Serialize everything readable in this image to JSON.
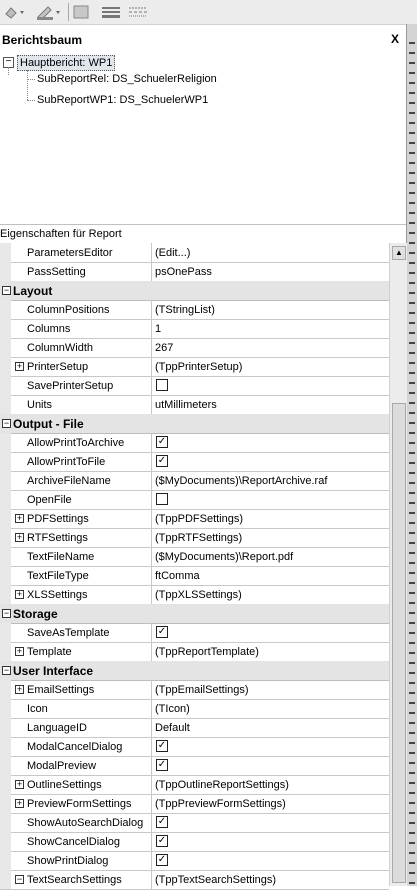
{
  "toolbar": {
    "icons": [
      "fill-color-icon",
      "pen-color-icon",
      "line-style-icon",
      "line-width-icon",
      "line-dash-icon"
    ]
  },
  "tree": {
    "title": "Berichtsbaum",
    "close": "X",
    "root": "Hauptbericht: WP1",
    "children": [
      "SubReportRel: DS_SchuelerReligion",
      "SubReportWP1: DS_SchuelerWP1"
    ]
  },
  "inspector": {
    "title": "Eigenschaften für Report",
    "rows": [
      {
        "kind": "prop",
        "name": "ParametersEditor",
        "value": "(Edit...)"
      },
      {
        "kind": "prop",
        "name": "PassSetting",
        "value": "psOnePass"
      },
      {
        "kind": "cat",
        "name": "Layout"
      },
      {
        "kind": "prop",
        "name": "ColumnPositions",
        "value": "(TStringList)"
      },
      {
        "kind": "prop",
        "name": "Columns",
        "value": "1"
      },
      {
        "kind": "prop",
        "name": "ColumnWidth",
        "value": "267"
      },
      {
        "kind": "prop",
        "name": "PrinterSetup",
        "value": "(TppPrinterSetup)",
        "expand": true
      },
      {
        "kind": "check",
        "name": "SavePrinterSetup",
        "checked": false
      },
      {
        "kind": "prop",
        "name": "Units",
        "value": "utMillimeters"
      },
      {
        "kind": "cat",
        "name": "Output - File"
      },
      {
        "kind": "check",
        "name": "AllowPrintToArchive",
        "checked": true
      },
      {
        "kind": "check",
        "name": "AllowPrintToFile",
        "checked": true
      },
      {
        "kind": "prop",
        "name": "ArchiveFileName",
        "value": "($MyDocuments)\\ReportArchive.raf"
      },
      {
        "kind": "check",
        "name": "OpenFile",
        "checked": false
      },
      {
        "kind": "prop",
        "name": "PDFSettings",
        "value": "(TppPDFSettings)",
        "expand": true
      },
      {
        "kind": "prop",
        "name": "RTFSettings",
        "value": "(TppRTFSettings)",
        "expand": true
      },
      {
        "kind": "prop",
        "name": "TextFileName",
        "value": "($MyDocuments)\\Report.pdf"
      },
      {
        "kind": "prop",
        "name": "TextFileType",
        "value": "ftComma"
      },
      {
        "kind": "prop",
        "name": "XLSSettings",
        "value": "(TppXLSSettings)",
        "expand": true
      },
      {
        "kind": "cat",
        "name": "Storage"
      },
      {
        "kind": "check",
        "name": "SaveAsTemplate",
        "checked": true
      },
      {
        "kind": "prop",
        "name": "Template",
        "value": "(TppReportTemplate)",
        "expand": true
      },
      {
        "kind": "cat",
        "name": "User Interface"
      },
      {
        "kind": "prop",
        "name": "EmailSettings",
        "value": "(TppEmailSettings)",
        "expand": true
      },
      {
        "kind": "prop",
        "name": "Icon",
        "value": "(TIcon)"
      },
      {
        "kind": "prop",
        "name": "LanguageID",
        "value": "Default"
      },
      {
        "kind": "check",
        "name": "ModalCancelDialog",
        "checked": true
      },
      {
        "kind": "check",
        "name": "ModalPreview",
        "checked": true
      },
      {
        "kind": "prop",
        "name": "OutlineSettings",
        "value": "(TppOutlineReportSettings)",
        "expand": true
      },
      {
        "kind": "prop",
        "name": "PreviewFormSettings",
        "value": "(TppPreviewFormSettings)",
        "expand": true
      },
      {
        "kind": "check",
        "name": "ShowAutoSearchDialog",
        "checked": true
      },
      {
        "kind": "check",
        "name": "ShowCancelDialog",
        "checked": true
      },
      {
        "kind": "check",
        "name": "ShowPrintDialog",
        "checked": true
      },
      {
        "kind": "prop",
        "name": "TextSearchSettings",
        "value": "(TppTextSearchSettings)",
        "expand": true,
        "expanded": true
      }
    ]
  }
}
